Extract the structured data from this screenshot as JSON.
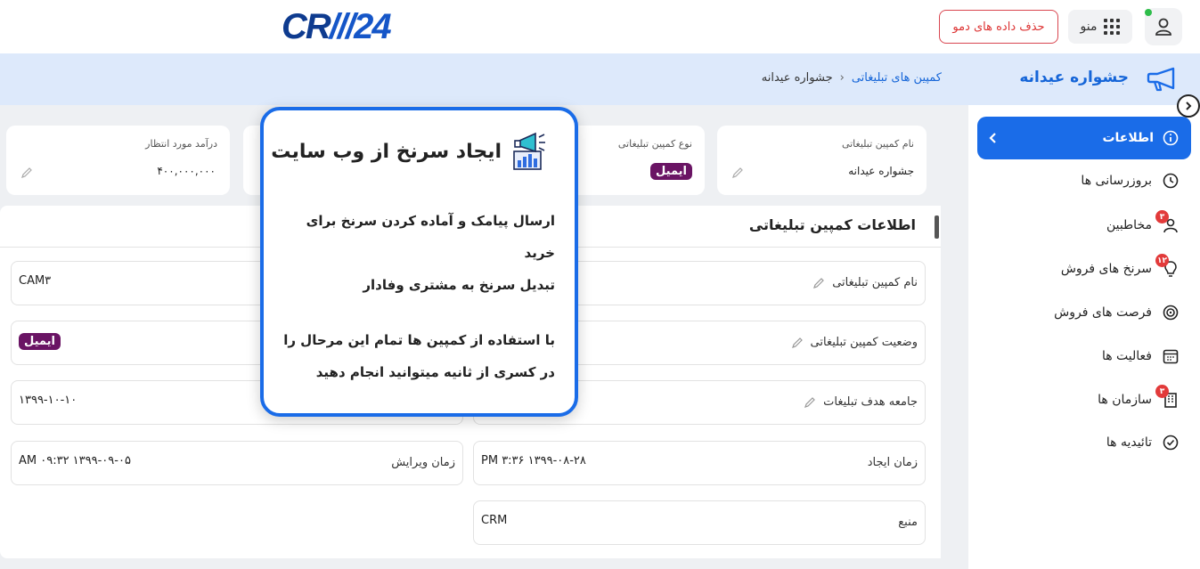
{
  "topbar": {
    "logo_prefix": "CR",
    "logo_suffix": "24",
    "menu_label": "منو",
    "demo_button": "حذف داده های دمو"
  },
  "header": {
    "page_title": "جشواره عیدانه",
    "breadcrumb": {
      "link": "کمپین های تبلیغاتی",
      "current": "جشواره عیدانه"
    }
  },
  "sidebar": {
    "active": "اطلاعات",
    "items": [
      {
        "label": "بروزرسانی ها",
        "icon": "history-icon",
        "badge": ""
      },
      {
        "label": "مخاطبین",
        "icon": "contacts-icon",
        "badge": "۳"
      },
      {
        "label": "سرنخ های فروش",
        "icon": "lightbulb-icon",
        "badge": "۱۲"
      },
      {
        "label": "فرصت های فروش",
        "icon": "target-icon",
        "badge": ""
      },
      {
        "label": "فعالیت ها",
        "icon": "calendar-icon",
        "badge": ""
      },
      {
        "label": "سازمان ها",
        "icon": "building-icon",
        "badge": "۳"
      },
      {
        "label": "تائیدیه ها",
        "icon": "check-circle-icon",
        "badge": ""
      }
    ]
  },
  "cards": {
    "name": {
      "title": "نام کمپین تبلیغاتی",
      "value": "جشواره عیدانه"
    },
    "type": {
      "title": "نوع کمپین تبلیغاتی",
      "value": "ایمیل"
    },
    "revenue": {
      "title": "درآمد مورد انتظار",
      "value": "۴۰۰,۰۰۰,۰۰۰"
    }
  },
  "section": {
    "title": "اطلاعات کمپین تبلیغاتی",
    "fields": {
      "name_label": "نام کمپین تبلیغاتی",
      "status_label": "وضعیت کمپین تبلیغاتی",
      "audience_label": "جامعه هدف تبلیغات",
      "created_label": "زمان ایجاد",
      "created_value": "PM ۳:۳۶ ۱۳۹۹-۰۸-۲۸",
      "edited_label": "زمان ویرایش",
      "edited_value": "AM ۰۹:۳۲ ۱۳۹۹-۰۹-۰۵",
      "source_label": "منبع",
      "source_value": "CRM",
      "code_value": "CAM۳",
      "type_value": "ایمیل",
      "date_value": "۱۳۹۹-۱۰-۱۰"
    }
  },
  "popup": {
    "title": "ایجاد سرنخ از وب سایت",
    "para1_line1": "ارسال پیامک و آماده کردن سرنخ برای خرید",
    "para1_line2": "تبدیل سرنخ به مشتری وفادار",
    "para2_line1": "با استفاده از کمپین ها تمام این مرحال را",
    "para2_line2": "در کسری از ثانیه میتوانید انجام دهید"
  },
  "colors": {
    "accent": "#1a6ce8",
    "tag": "#6a1464",
    "badge": "#e23a3a",
    "header_bg": "#dde9fb"
  }
}
